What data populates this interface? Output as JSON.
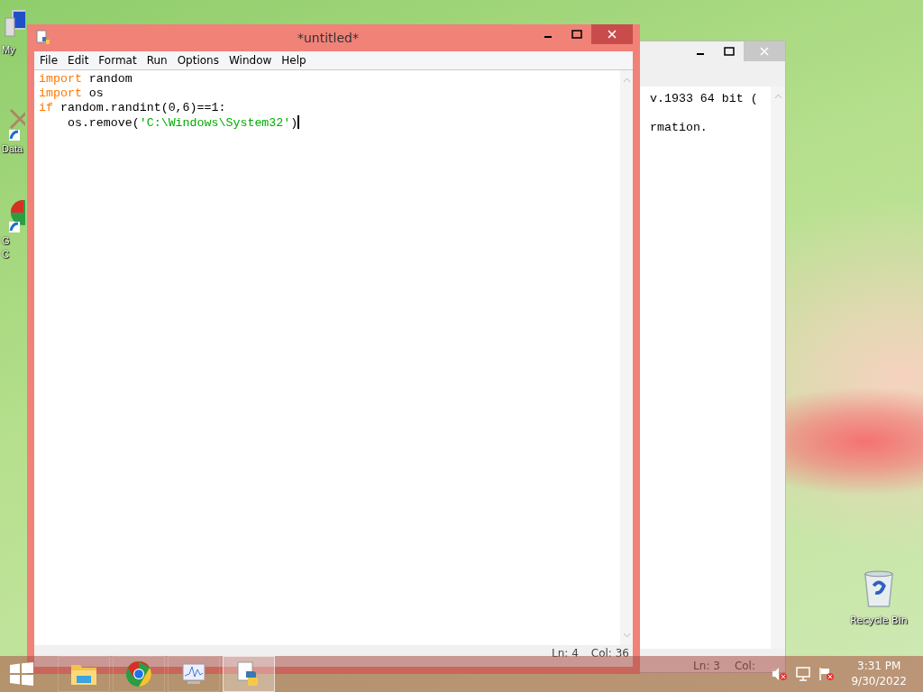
{
  "desktop_icons": [
    {
      "kind": "computer",
      "lines": [
        "My"
      ]
    },
    {
      "kind": "shortcut",
      "lines": [
        "Data"
      ]
    },
    {
      "kind": "chrome",
      "lines": [
        "G",
        "C"
      ]
    }
  ],
  "recycle_bin": {
    "label": "Recycle Bin"
  },
  "shell_window": {
    "lines": [
      "v.1933 64 bit (",
      "rmation."
    ],
    "status": {
      "line": "Ln: 3",
      "col": "Col:"
    }
  },
  "editor": {
    "title": "*untitled*",
    "menu": [
      "File",
      "Edit",
      "Format",
      "Run",
      "Options",
      "Window",
      "Help"
    ],
    "code": [
      [
        {
          "kind": "keyword",
          "text": "import"
        },
        {
          "kind": "plain",
          "text": " random"
        }
      ],
      [
        {
          "kind": "keyword",
          "text": "import"
        },
        {
          "kind": "plain",
          "text": " os"
        }
      ],
      [
        {
          "kind": "keyword",
          "text": "if"
        },
        {
          "kind": "plain",
          "text": " random.randint(0,6)==1:"
        }
      ],
      [
        {
          "kind": "plain",
          "text": "    os.remove("
        },
        {
          "kind": "string",
          "text": "'C:\\Windows\\System32'"
        },
        {
          "kind": "plain",
          "text": ")"
        }
      ]
    ],
    "status": {
      "line": "Ln: 4",
      "col": "Col: 36"
    }
  },
  "taskbar": {
    "apps": [
      {
        "kind": "explorer",
        "selected": false
      },
      {
        "kind": "chrome",
        "selected": false
      },
      {
        "kind": "monitor",
        "selected": false
      },
      {
        "kind": "python",
        "selected": true
      }
    ],
    "clock": {
      "time": "3:31 PM",
      "date": "9/30/2022"
    }
  }
}
